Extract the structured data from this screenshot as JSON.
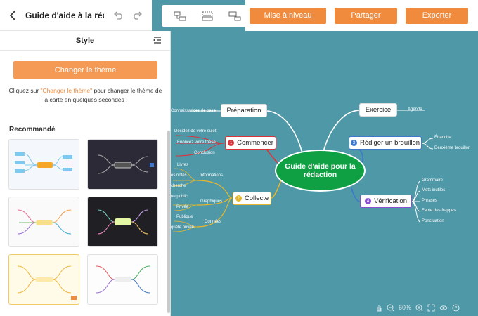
{
  "header": {
    "title": "Guide d'aide à la rédac",
    "upgrade_label": "Mise à niveau",
    "share_label": "Partager",
    "export_label": "Exporter"
  },
  "panel": {
    "title": "Style",
    "theme_button": "Changer le thème",
    "hint_before": "Cliquez sur ",
    "hint_link": "\"Changer le thème\"",
    "hint_after": " pour changer le thème de la carte en quelques secondes !",
    "recommended": "Recommandé"
  },
  "map": {
    "center": "Guide d'aide pour la rédaction",
    "branches": {
      "preparation": "Préparation",
      "commencer": "Commencer",
      "collecte": "Collecte",
      "exercice": "Exercice",
      "brouillon": "Rédiger un brouillon",
      "verification": "Vérification"
    },
    "numbers": {
      "commencer": "1",
      "collecte": "2",
      "brouillon": "3",
      "verification": "4"
    },
    "leaves": {
      "connaissances": "Connaissances de base",
      "decidez": "Décidez de votre sujet",
      "enoncez": "Énoncez votre thèse",
      "conclusion": "Conclusion",
      "livres": "Livres",
      "notes": "es notes",
      "informations": "Informations",
      "recherche": "cherche",
      "public": "ne public",
      "graphiques": "Graphiques",
      "privee": "Privée",
      "publique": "Publique",
      "donnees": "Données",
      "enquete": "quête privée",
      "agenda": "Agenda",
      "ebauche": "Ébauche",
      "deuxieme": "Deuxième brouillon",
      "grammaire": "Grammaire",
      "mots": "Mots inutiles",
      "phrases": "Phrases",
      "fautes": "Faute des frappes",
      "ponctuation": "Ponctuation"
    }
  },
  "zoom": "60%",
  "colors": {
    "canvas": "#4e98a7",
    "accent": "#f08a3c",
    "center": "#0fa044",
    "red": "#d9343c",
    "yellow": "#e8b62c",
    "purple": "#8a4fd0",
    "blue": "#3f79c9"
  }
}
